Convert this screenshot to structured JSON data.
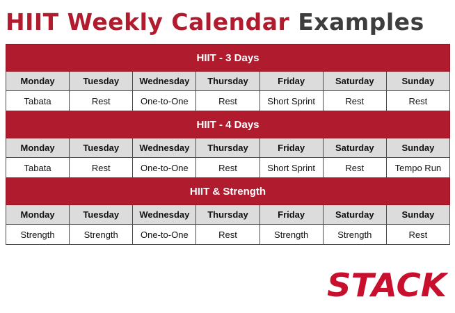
{
  "title": {
    "part1": "HIIT Weekly Calendar",
    "part2": "Examples"
  },
  "days": [
    "Monday",
    "Tuesday",
    "Wednesday",
    "Thursday",
    "Friday",
    "Saturday",
    "Sunday"
  ],
  "sections": [
    {
      "title": "HIIT - 3 Days",
      "workouts": [
        "Tabata",
        "Rest",
        "One-to-One",
        "Rest",
        "Short Sprint",
        "Rest",
        "Rest"
      ]
    },
    {
      "title": "HIIT - 4 Days",
      "workouts": [
        "Tabata",
        "Rest",
        "One-to-One",
        "Rest",
        "Short Sprint",
        "Rest",
        "Tempo Run"
      ]
    },
    {
      "title": "HIIT & Strength",
      "workouts": [
        "Strength",
        "Strength",
        "One-to-One",
        "Rest",
        "Strength",
        "Strength",
        "Rest"
      ]
    }
  ],
  "logo": {
    "text": "STACK",
    "color": "#c8102e"
  },
  "colors": {
    "accent": "#b01b2e",
    "dark": "#3d3d3d",
    "header_bg": "#dcdcdc"
  }
}
